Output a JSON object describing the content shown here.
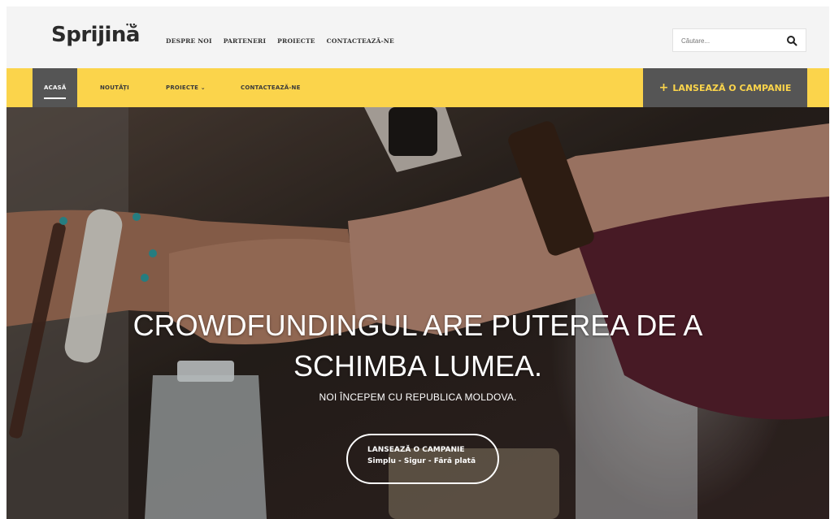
{
  "brand": {
    "name": "Sprijină",
    "dots": "•••"
  },
  "top_nav": [
    "DESPRE NOI",
    "PARTENERI",
    "PROIECTE",
    "CONTACTEAZĂ-NE"
  ],
  "search": {
    "placeholder": "Căutare..."
  },
  "main_nav": {
    "items": [
      {
        "label": "ACASĂ",
        "active": true
      },
      {
        "label": "NOUTĂȚI",
        "active": false
      },
      {
        "label": "PROIECTE ⌄",
        "active": false
      },
      {
        "label": "CONTACTEAZĂ-NE",
        "active": false
      }
    ]
  },
  "campaign_button": {
    "plus": "+",
    "label": "LANSEAZĂ O CAMPANIE"
  },
  "hero": {
    "headline_line1": "CROWDFUNDINGUL ARE PUTEREA DE A",
    "headline_line2": "SCHIMBA LUMEA.",
    "subheadline": "NOI ÎNCEPEM CU REPUBLICA MOLDOVA.",
    "cta_title": "LANSEAZĂ O CAMPANIE",
    "cta_subtitle": "Simplu - Sigur - Fără plată"
  },
  "colors": {
    "accent": "#fbd44b",
    "dark": "#555555",
    "text": "#2b2b2b"
  },
  "icons": {
    "search": "search-icon",
    "plus": "plus-icon"
  }
}
